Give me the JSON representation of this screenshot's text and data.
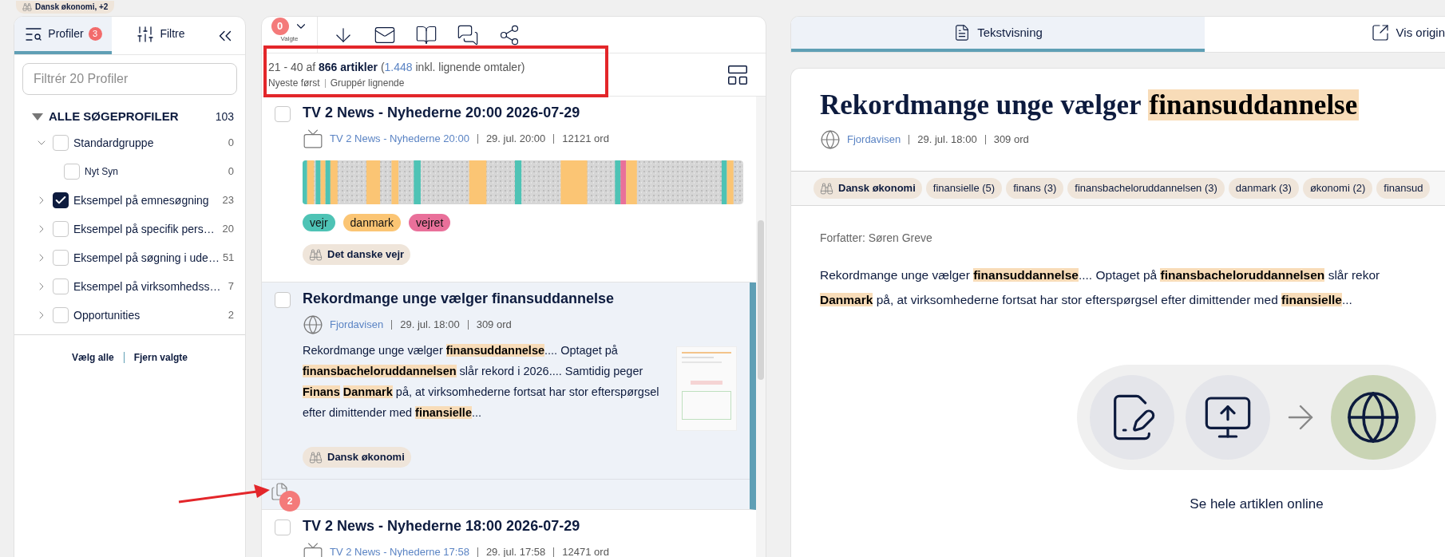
{
  "top_chip": {
    "label": "Dansk økonomi, +2"
  },
  "profiles_panel": {
    "tabs": [
      {
        "label": "Profiler",
        "badge": "3",
        "selected": true
      },
      {
        "label": "Filtre",
        "selected": false
      }
    ],
    "filter": {
      "placeholder": "Filtrér 20 Profiler"
    },
    "tree": {
      "label": "ALLE SØGEPROFILER",
      "count": "103",
      "expanded": true,
      "children": [
        {
          "label": "Standardgruppe",
          "count": "0",
          "expanded": true,
          "checked": false,
          "children": [
            {
              "label": "Nyt Syn",
              "count": "0",
              "checked": false
            }
          ]
        },
        {
          "label": "Eksempel på emnesøgning",
          "count": "23",
          "expanded": false,
          "checked": true
        },
        {
          "label": "Eksempel på specifik pers…",
          "count": "20",
          "expanded": false,
          "checked": false
        },
        {
          "label": "Eksempel på søgning i ude…",
          "count": "51",
          "expanded": false,
          "checked": false
        },
        {
          "label": "Eksempel på virksomhedss…",
          "count": "7",
          "expanded": false,
          "checked": false
        },
        {
          "label": "Opportunities",
          "count": "2",
          "expanded": false,
          "checked": false
        }
      ]
    },
    "actions": [
      "Vælg alle",
      "Fjern valgte"
    ]
  },
  "results": {
    "selected_count": "0",
    "selected_label": "Valgte",
    "summary": {
      "range": "21 - 40 af",
      "total": "866 artikler",
      "similar_prefix": "(",
      "similar_count": "1.448",
      "similar_rest": "inkl. lignende omtaler)"
    },
    "sort": "Nyeste først",
    "grouping": "Gruppér lignende",
    "articles": [
      {
        "kind": "broadcast",
        "selected": false,
        "checked": false,
        "title": "TV 2 News - Nyhederne 20:00 2026-07-29",
        "source": "TV 2 News - Nyhederne 20:00",
        "date": "29. jul. 20:00",
        "words": "12121 ord",
        "tags": [
          {
            "label": "vejr",
            "color": "#4ec3b5"
          },
          {
            "label": "danmark",
            "color": "#fbc574"
          },
          {
            "label": "vejret",
            "color": "#e9709a"
          }
        ],
        "profiles": [
          "Det danske vejr"
        ]
      },
      {
        "kind": "web",
        "selected": true,
        "checked": false,
        "title": "Rekordmange unge vælger finansuddannelse",
        "source": "Fjordavisen",
        "date": "29. jul. 18:00",
        "words": "309 ord",
        "snippet": [
          {
            "text": "Rekordmange unge vælger ",
            "hit": false
          },
          {
            "text": "finansuddannelse",
            "hit": true
          },
          {
            "text": ".... Optaget på ",
            "hit": false
          },
          {
            "text": "finansbacheloruddannelsen",
            "hit": true
          },
          {
            "text": " slår rekord i 2026.... Samtidig peger ",
            "hit": false
          },
          {
            "text": "Finans",
            "hit": true
          },
          {
            "text": "Danmark",
            "hit": true
          },
          {
            "text": " på, at virksomhederne fortsat har stor efterspørgsel efter dimittender med ",
            "hit": false
          },
          {
            "text": "finansielle",
            "hit": true
          },
          {
            "text": "...",
            "hit": false
          }
        ],
        "profiles": [
          "Dansk økonomi"
        ],
        "similar": "2"
      },
      {
        "kind": "broadcast",
        "selected": false,
        "checked": false,
        "title": "TV 2 News - Nyhederne 18:00 2026-07-29",
        "source": "TV 2 News - Nyhederne 17:58",
        "date": "29. jul. 17:58",
        "words": "12471 ord"
      }
    ]
  },
  "reader": {
    "tabs": [
      {
        "label": "Tekstvisning",
        "selected": true
      },
      {
        "label": "Vis origin",
        "selected": false
      }
    ],
    "title": [
      {
        "text": "Rekordmange unge vælger ",
        "hit": false
      },
      {
        "text": "finansuddannelse",
        "hit": true
      }
    ],
    "source": "Fjordavisen",
    "date": "29. jul. 18:00",
    "words": "309 ord",
    "chips": [
      {
        "kind": "profile",
        "label": "Dansk økonomi"
      },
      {
        "kind": "keyword",
        "label": "finansielle (5)"
      },
      {
        "kind": "keyword",
        "label": "finans (3)"
      },
      {
        "kind": "keyword",
        "label": "finansbacheloruddannelsen (3)"
      },
      {
        "kind": "keyword",
        "label": "danmark (3)"
      },
      {
        "kind": "keyword",
        "label": "økonomi (2)"
      },
      {
        "kind": "keyword",
        "label": "finansud"
      }
    ],
    "author": "Forfatter: Søren Greve",
    "body_lines": [
      [
        {
          "text": "Rekordmange unge vælger ",
          "hit": false
        },
        {
          "text": "finansuddannelse",
          "hit": true
        },
        {
          "text": ".... Optaget på ",
          "hit": false
        },
        {
          "text": "finansbacheloruddannelsen",
          "hit": true
        },
        {
          "text": " slår rekor",
          "hit": false
        }
      ],
      [
        {
          "text": "Danmark",
          "hit": true
        },
        {
          "text": " på, at virksomhederne fortsat har stor efterspørgsel efter dimittender med ",
          "hit": false
        },
        {
          "text": "finansielle",
          "hit": true
        },
        {
          "text": "...",
          "hit": false
        }
      ]
    ],
    "online_label": "Se hele artiklen online"
  }
}
